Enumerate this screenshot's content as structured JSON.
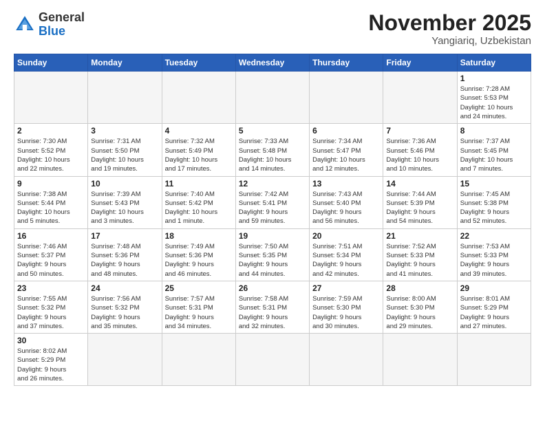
{
  "header": {
    "logo": {
      "general": "General",
      "blue": "Blue"
    },
    "title": "November 2025",
    "location": "Yangiariq, Uzbekistan"
  },
  "weekdays": [
    "Sunday",
    "Monday",
    "Tuesday",
    "Wednesday",
    "Thursday",
    "Friday",
    "Saturday"
  ],
  "weeks": [
    [
      {
        "day": "",
        "info": ""
      },
      {
        "day": "",
        "info": ""
      },
      {
        "day": "",
        "info": ""
      },
      {
        "day": "",
        "info": ""
      },
      {
        "day": "",
        "info": ""
      },
      {
        "day": "",
        "info": ""
      },
      {
        "day": "1",
        "info": "Sunrise: 7:28 AM\nSunset: 5:53 PM\nDaylight: 10 hours\nand 24 minutes."
      }
    ],
    [
      {
        "day": "2",
        "info": "Sunrise: 7:30 AM\nSunset: 5:52 PM\nDaylight: 10 hours\nand 22 minutes."
      },
      {
        "day": "3",
        "info": "Sunrise: 7:31 AM\nSunset: 5:50 PM\nDaylight: 10 hours\nand 19 minutes."
      },
      {
        "day": "4",
        "info": "Sunrise: 7:32 AM\nSunset: 5:49 PM\nDaylight: 10 hours\nand 17 minutes."
      },
      {
        "day": "5",
        "info": "Sunrise: 7:33 AM\nSunset: 5:48 PM\nDaylight: 10 hours\nand 14 minutes."
      },
      {
        "day": "6",
        "info": "Sunrise: 7:34 AM\nSunset: 5:47 PM\nDaylight: 10 hours\nand 12 minutes."
      },
      {
        "day": "7",
        "info": "Sunrise: 7:36 AM\nSunset: 5:46 PM\nDaylight: 10 hours\nand 10 minutes."
      },
      {
        "day": "8",
        "info": "Sunrise: 7:37 AM\nSunset: 5:45 PM\nDaylight: 10 hours\nand 7 minutes."
      }
    ],
    [
      {
        "day": "9",
        "info": "Sunrise: 7:38 AM\nSunset: 5:44 PM\nDaylight: 10 hours\nand 5 minutes."
      },
      {
        "day": "10",
        "info": "Sunrise: 7:39 AM\nSunset: 5:43 PM\nDaylight: 10 hours\nand 3 minutes."
      },
      {
        "day": "11",
        "info": "Sunrise: 7:40 AM\nSunset: 5:42 PM\nDaylight: 10 hours\nand 1 minute."
      },
      {
        "day": "12",
        "info": "Sunrise: 7:42 AM\nSunset: 5:41 PM\nDaylight: 9 hours\nand 59 minutes."
      },
      {
        "day": "13",
        "info": "Sunrise: 7:43 AM\nSunset: 5:40 PM\nDaylight: 9 hours\nand 56 minutes."
      },
      {
        "day": "14",
        "info": "Sunrise: 7:44 AM\nSunset: 5:39 PM\nDaylight: 9 hours\nand 54 minutes."
      },
      {
        "day": "15",
        "info": "Sunrise: 7:45 AM\nSunset: 5:38 PM\nDaylight: 9 hours\nand 52 minutes."
      }
    ],
    [
      {
        "day": "16",
        "info": "Sunrise: 7:46 AM\nSunset: 5:37 PM\nDaylight: 9 hours\nand 50 minutes."
      },
      {
        "day": "17",
        "info": "Sunrise: 7:48 AM\nSunset: 5:36 PM\nDaylight: 9 hours\nand 48 minutes."
      },
      {
        "day": "18",
        "info": "Sunrise: 7:49 AM\nSunset: 5:36 PM\nDaylight: 9 hours\nand 46 minutes."
      },
      {
        "day": "19",
        "info": "Sunrise: 7:50 AM\nSunset: 5:35 PM\nDaylight: 9 hours\nand 44 minutes."
      },
      {
        "day": "20",
        "info": "Sunrise: 7:51 AM\nSunset: 5:34 PM\nDaylight: 9 hours\nand 42 minutes."
      },
      {
        "day": "21",
        "info": "Sunrise: 7:52 AM\nSunset: 5:33 PM\nDaylight: 9 hours\nand 41 minutes."
      },
      {
        "day": "22",
        "info": "Sunrise: 7:53 AM\nSunset: 5:33 PM\nDaylight: 9 hours\nand 39 minutes."
      }
    ],
    [
      {
        "day": "23",
        "info": "Sunrise: 7:55 AM\nSunset: 5:32 PM\nDaylight: 9 hours\nand 37 minutes."
      },
      {
        "day": "24",
        "info": "Sunrise: 7:56 AM\nSunset: 5:32 PM\nDaylight: 9 hours\nand 35 minutes."
      },
      {
        "day": "25",
        "info": "Sunrise: 7:57 AM\nSunset: 5:31 PM\nDaylight: 9 hours\nand 34 minutes."
      },
      {
        "day": "26",
        "info": "Sunrise: 7:58 AM\nSunset: 5:31 PM\nDaylight: 9 hours\nand 32 minutes."
      },
      {
        "day": "27",
        "info": "Sunrise: 7:59 AM\nSunset: 5:30 PM\nDaylight: 9 hours\nand 30 minutes."
      },
      {
        "day": "28",
        "info": "Sunrise: 8:00 AM\nSunset: 5:30 PM\nDaylight: 9 hours\nand 29 minutes."
      },
      {
        "day": "29",
        "info": "Sunrise: 8:01 AM\nSunset: 5:29 PM\nDaylight: 9 hours\nand 27 minutes."
      }
    ],
    [
      {
        "day": "30",
        "info": "Sunrise: 8:02 AM\nSunset: 5:29 PM\nDaylight: 9 hours\nand 26 minutes."
      },
      {
        "day": "",
        "info": ""
      },
      {
        "day": "",
        "info": ""
      },
      {
        "day": "",
        "info": ""
      },
      {
        "day": "",
        "info": ""
      },
      {
        "day": "",
        "info": ""
      },
      {
        "day": "",
        "info": ""
      }
    ]
  ]
}
